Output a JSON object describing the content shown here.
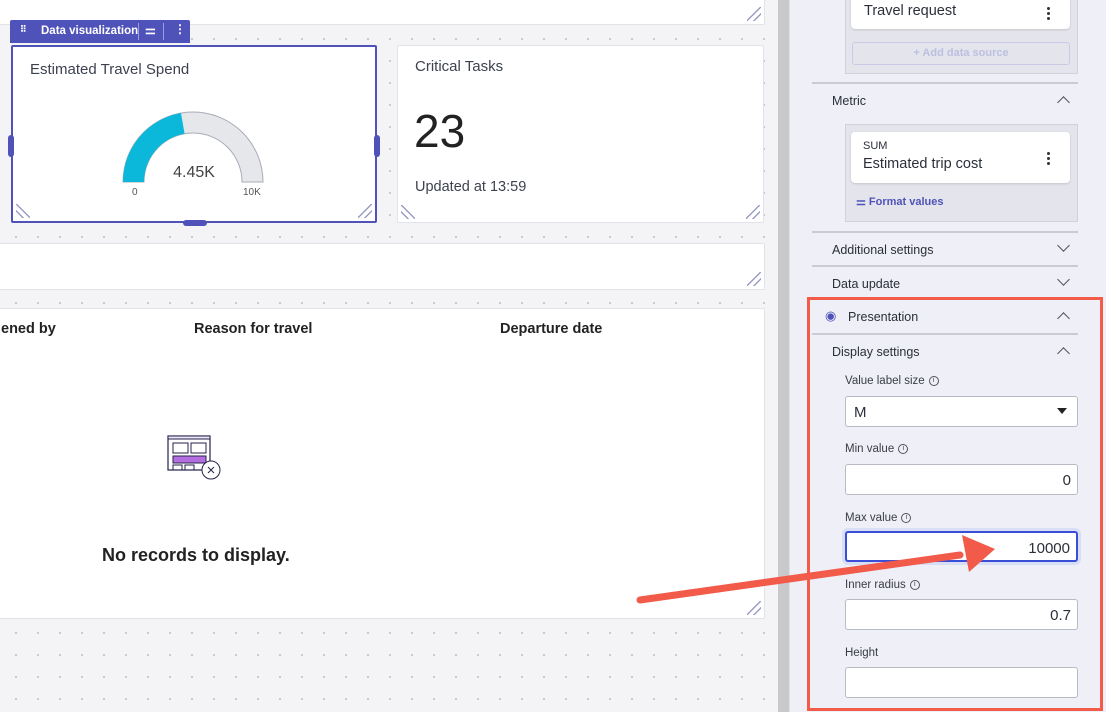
{
  "toolbar": {
    "label": "Data visualization",
    "drag_icon": "drag-handle-icon",
    "settings_icon": "sliders-icon",
    "more_icon": "more-vertical-icon"
  },
  "gauge_card": {
    "title": "Estimated Travel Spend",
    "value_label": "4.45K",
    "min_label": "0",
    "max_label": "10K",
    "value": 4450,
    "min": 0,
    "max": 10000,
    "fill_color": "#0bb8d9",
    "track_color": "#e6e7eb"
  },
  "tasks_card": {
    "title": "Critical Tasks",
    "value": "23",
    "updated": "Updated at 13:59"
  },
  "table_card": {
    "columns": [
      "ened by",
      "Reason for travel",
      "Departure date"
    ],
    "empty_icon": "no-records-icon",
    "empty_text": "No records to display."
  },
  "panel": {
    "data_source": {
      "name": "Travel request",
      "add_label": "+ Add data source"
    },
    "metric": {
      "header": "Metric",
      "aggregation": "SUM",
      "field": "Estimated trip cost",
      "format_label": "Format values"
    },
    "additional_settings": "Additional settings",
    "data_update": "Data update",
    "presentation": {
      "header": "Presentation",
      "display_settings": "Display settings",
      "value_label_size": {
        "label": "Value label size",
        "value": "M"
      },
      "min_value": {
        "label": "Min value",
        "value": "0"
      },
      "max_value": {
        "label": "Max value",
        "value": "10000"
      },
      "inner_radius": {
        "label": "Inner radius",
        "value": "0.7"
      },
      "height": {
        "label": "Height",
        "value": ""
      }
    }
  },
  "colors": {
    "accent": "#4f52b8",
    "highlight": "#f25a4a"
  }
}
